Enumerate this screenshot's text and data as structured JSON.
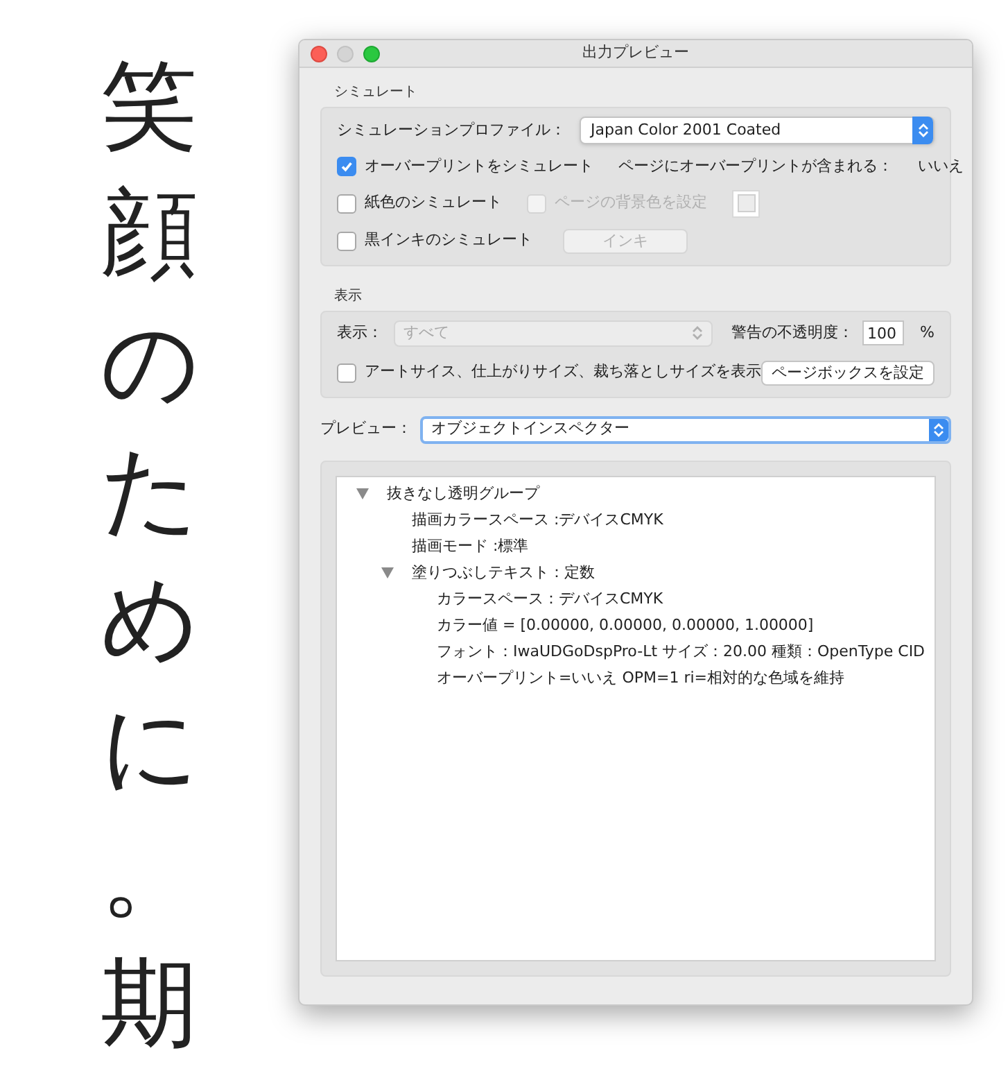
{
  "document": {
    "vertical_text": "笑顔のために。期"
  },
  "window": {
    "title": "出力プレビュー"
  },
  "simulation": {
    "heading": "シミュレート",
    "profile_label": "シミュレーションプロファイル：",
    "profile_value": "Japan Color 2001 Coated",
    "options": [
      {
        "label": "オーバープリントをシミュレート",
        "checked": true,
        "disabled": false
      },
      {
        "label": "紙色のシミュレート",
        "checked": false,
        "disabled": false
      },
      {
        "label": "ページの背景色を設定",
        "checked": false,
        "disabled": true
      },
      {
        "label": "黒インキのシミュレート",
        "checked": false,
        "disabled": false
      }
    ],
    "overprint_info_label": "ページにオーバープリントが含まれる：",
    "overprint_info_value": "いいえ",
    "ink_button": {
      "label": "インキ",
      "disabled": true
    }
  },
  "display": {
    "heading": "表示",
    "show_label": "表示：",
    "show_value": "すべて",
    "show_disabled": true,
    "opacity_label": "警告の不透明度：",
    "opacity_value": "100",
    "unit": "%",
    "boxes": {
      "label": "アートサイス、仕上がりサイズ、裁ち落としサイズを表示",
      "checked": false
    },
    "page_box_button": "ページボックスを設定"
  },
  "preview": {
    "label": "プレビュー：",
    "value": "オブジェクトインスペクター"
  },
  "inspector": {
    "items": [
      {
        "label": "抜きなし透明グループ",
        "expanded": true,
        "children": [
          {
            "label": "描画カラースペース :デバイスCMYK"
          },
          {
            "label": "描画モード :標準"
          },
          {
            "label": "塗りつぶしテキスト：定数",
            "expanded": true,
            "children": [
              {
                "label": "カラースペース：デバイスCMYK"
              },
              {
                "label": "カラー値 = [0.00000, 0.00000, 0.00000, 1.00000]"
              },
              {
                "label": "フォント：IwaUDGoDspPro-Lt サイズ：20.00 種類：OpenType CID"
              },
              {
                "label": "オーバープリント=いいえ OPM=1 ri=相対的な色域を維持"
              }
            ]
          }
        ]
      }
    ]
  }
}
